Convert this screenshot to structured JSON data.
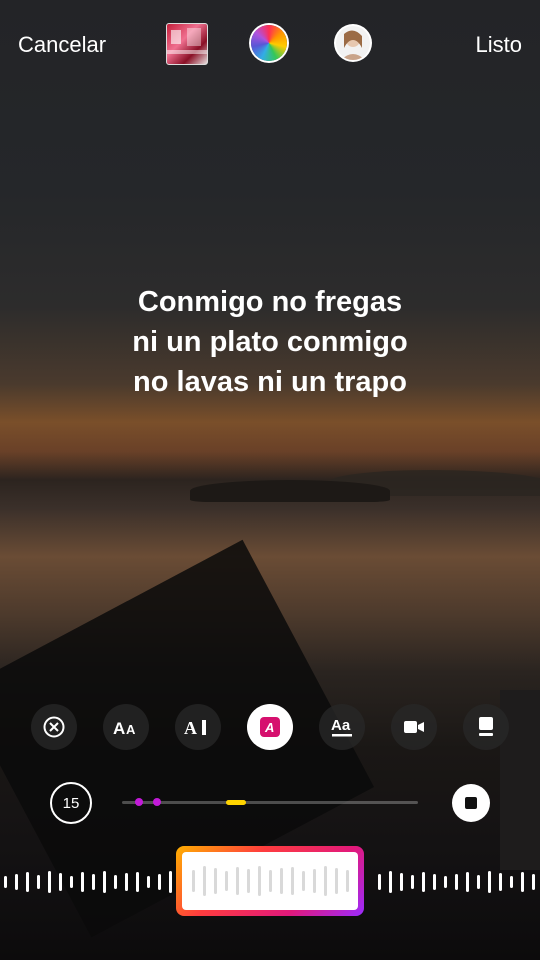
{
  "header": {
    "cancel_label": "Cancelar",
    "done_label": "Listo",
    "album_cover_icon": "album-cover-thumbnail",
    "color_picker_icon": "color-wheel-icon",
    "avatar_icon": "profile-avatar"
  },
  "lyrics": {
    "lines": [
      "Conmigo no fregas",
      "ni un plato conmigo",
      "no lavas ni un trapo"
    ]
  },
  "style_options": [
    {
      "name": "remove",
      "icon": "close-circle-icon",
      "label": "⊗"
    },
    {
      "name": "style-typewriter",
      "icon": "text-size-icon",
      "label": "AA"
    },
    {
      "name": "style-cursor",
      "icon": "text-cursor-icon",
      "label": "A"
    },
    {
      "name": "style-highlight",
      "icon": "highlight-text-icon",
      "label": "A",
      "active": true
    },
    {
      "name": "style-underline",
      "icon": "underline-text-icon",
      "label": "Aa"
    },
    {
      "name": "video-mode",
      "icon": "video-camera-icon",
      "label": ""
    },
    {
      "name": "album-card",
      "icon": "album-card-icon",
      "label": ""
    }
  ],
  "timeline": {
    "duration_label": "15",
    "progress": 0.35,
    "accent": "#c21ad8",
    "highlight": "#ffd400"
  },
  "colors": {
    "selector_gradient": [
      "#ffb000",
      "#ff3d3d",
      "#e2197b",
      "#9b2bff"
    ],
    "active_style_pink": "#d6106e"
  }
}
